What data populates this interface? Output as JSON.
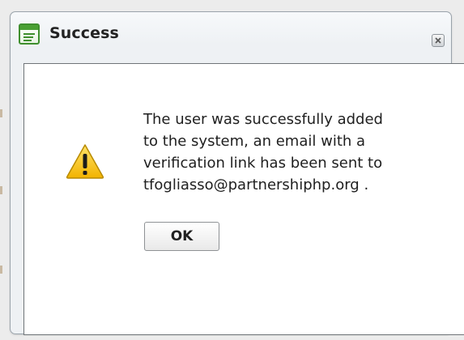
{
  "dialog": {
    "title": "Success",
    "title_icon": "window-icon",
    "close_icon": "close-icon",
    "message_lines": [
      "The user was successfully added",
      "to the system, an email with a",
      "verification link has been sent to",
      "tfogliasso@partnershiphp.org ."
    ],
    "warning_icon": "warning-icon",
    "ok_label": "OK"
  },
  "colors": {
    "title_icon_green": "#4aa033",
    "warning_yellow": "#f5c400",
    "content_border": "#6f7478"
  }
}
